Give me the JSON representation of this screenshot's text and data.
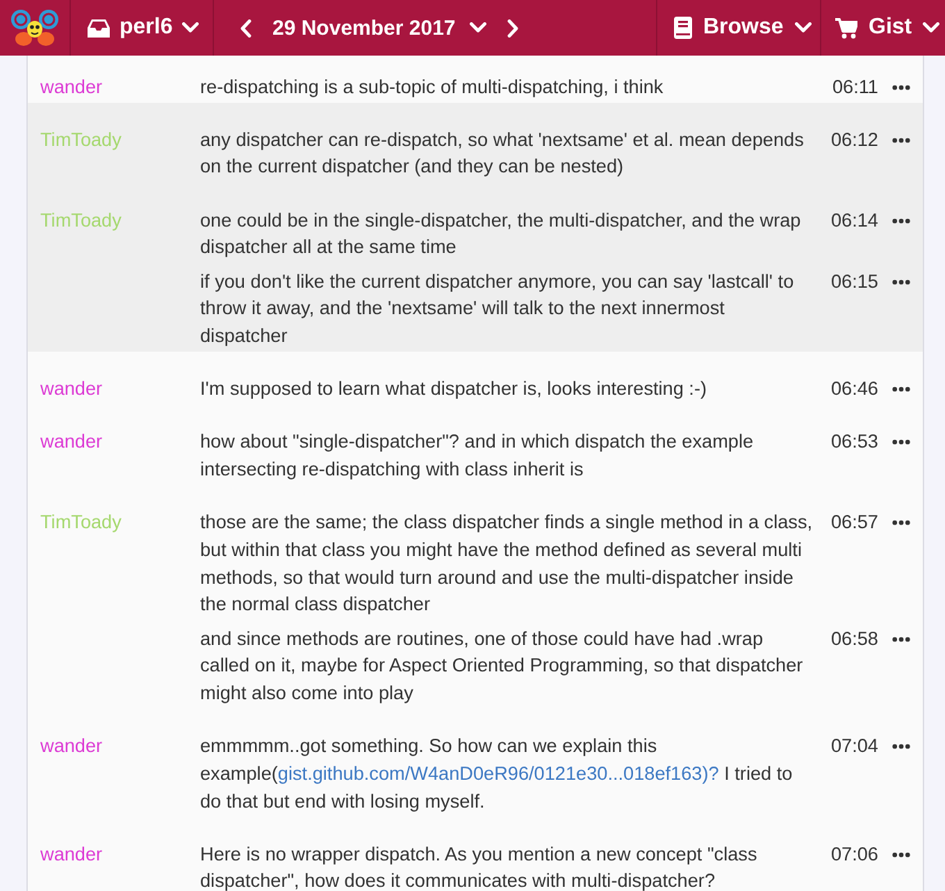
{
  "header": {
    "channel": {
      "label": "perl6"
    },
    "date": {
      "label": "29 November 2017"
    },
    "menus": [
      {
        "kind": "book",
        "label": "Browse"
      },
      {
        "kind": "cart",
        "label": "Gist"
      }
    ]
  },
  "log": {
    "groups": [
      {
        "nick": "wander",
        "color": "#dc3bd4",
        "highlighted": false,
        "messages": [
          {
            "text": "re-dispatching is a sub-topic of multi-dispatching, i think",
            "time": "06:11"
          }
        ]
      },
      {
        "nick": "TimToady",
        "color": "#a5d86e",
        "highlighted": true,
        "messages": [
          {
            "text": "any dispatcher can re-dispatch, so what 'nextsame' et al. mean depends on the current dispatcher (and they can be nested)",
            "time": "06:12"
          }
        ]
      },
      {
        "nick": "TimToady",
        "color": "#a5d86e",
        "highlighted": true,
        "messages": [
          {
            "text": "one could be in the single-dispatcher, the multi-dispatcher, and the wrap dispatcher all at the same time",
            "time": "06:14"
          },
          {
            "text": "if you don't like the current dispatcher anymore, you can say 'lastcall' to throw it away, and the 'nextsame' will talk to the next innermost dispatcher",
            "time": "06:15"
          }
        ]
      },
      {
        "nick": "wander",
        "color": "#dc3bd4",
        "highlighted": false,
        "messages": [
          {
            "text": "I'm supposed to learn what dispatcher is, looks interesting :-)",
            "time": "06:46"
          }
        ]
      },
      {
        "nick": "wander",
        "color": "#dc3bd4",
        "highlighted": false,
        "messages": [
          {
            "text": "how about \"single-dispatcher\"? and in which dispatch the example intersecting re-dispatching with class inherit is",
            "time": "06:53"
          }
        ]
      },
      {
        "nick": "TimToady",
        "color": "#a5d86e",
        "highlighted": false,
        "messages": [
          {
            "text": "those are the same; the class dispatcher finds a single method in a class, but within that class you might have the method defined as several multi methods, so that would turn around and use the multi-dispatcher inside the normal class dispatcher",
            "time": "06:57"
          },
          {
            "text": "and since methods are routines, one of those could have had .wrap called on it, maybe for Aspect Oriented Programming, so that dispatcher might also come into play",
            "time": "06:58"
          }
        ]
      },
      {
        "nick": "wander",
        "color": "#dc3bd4",
        "highlighted": false,
        "messages": [
          {
            "parts": [
              {
                "kind": "text",
                "text": "emmmmm..got something. So how can we explain this example("
              },
              {
                "kind": "link",
                "text": "gist.github.com/W4anD0eR96/0121e30...018ef163)?"
              },
              {
                "kind": "text",
                "text": " I tried to do that but end with losing myself."
              }
            ],
            "time": "07:04"
          }
        ]
      },
      {
        "nick": "wander",
        "color": "#dc3bd4",
        "highlighted": false,
        "messages": [
          {
            "text": "Here is no wrapper dispatch. As you mention a new concept \"class dispatcher\", how does it communicates with multi-dispatcher?",
            "time": "07:06"
          }
        ]
      }
    ]
  }
}
